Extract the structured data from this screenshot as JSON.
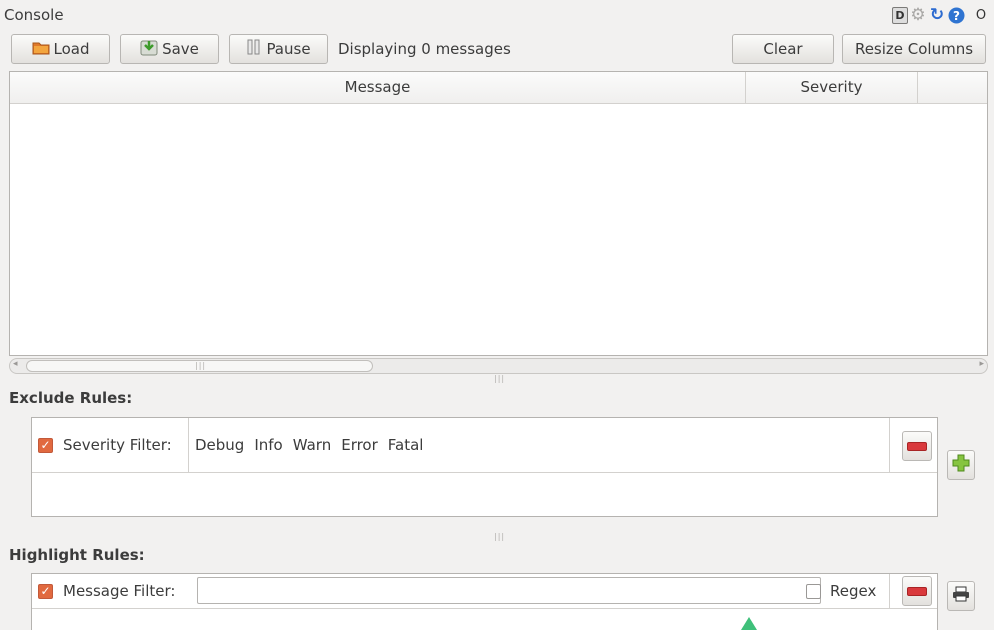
{
  "panel": {
    "title": "Console"
  },
  "title_icons": [
    "help-d-icon",
    "gear-icon",
    "reload-icon",
    "help-icon",
    "close-icon"
  ],
  "title_icon_labels": {
    "d": "D",
    "close": "O"
  },
  "toolbar": {
    "load_label": "Load",
    "save_label": "Save",
    "pause_label": "Pause",
    "status_text": "Displaying 0 messages",
    "clear_label": "Clear",
    "resize_label": "Resize Columns"
  },
  "table": {
    "columns": [
      "Message",
      "Severity"
    ],
    "rows": []
  },
  "exclude": {
    "label": "Exclude Rules:",
    "rules": [
      {
        "enabled": true,
        "name": "Severity Filter:",
        "levels": [
          "Debug",
          "Info",
          "Warn",
          "Error",
          "Fatal"
        ]
      }
    ]
  },
  "highlight": {
    "label": "Highlight Rules:",
    "rules": [
      {
        "enabled": true,
        "name": "Message Filter:",
        "value": "",
        "regex_label": "Regex",
        "regex": false
      }
    ]
  },
  "colors": {
    "accent": "#e1693f",
    "remove": "#d9393c",
    "add": "#6fb52c"
  }
}
